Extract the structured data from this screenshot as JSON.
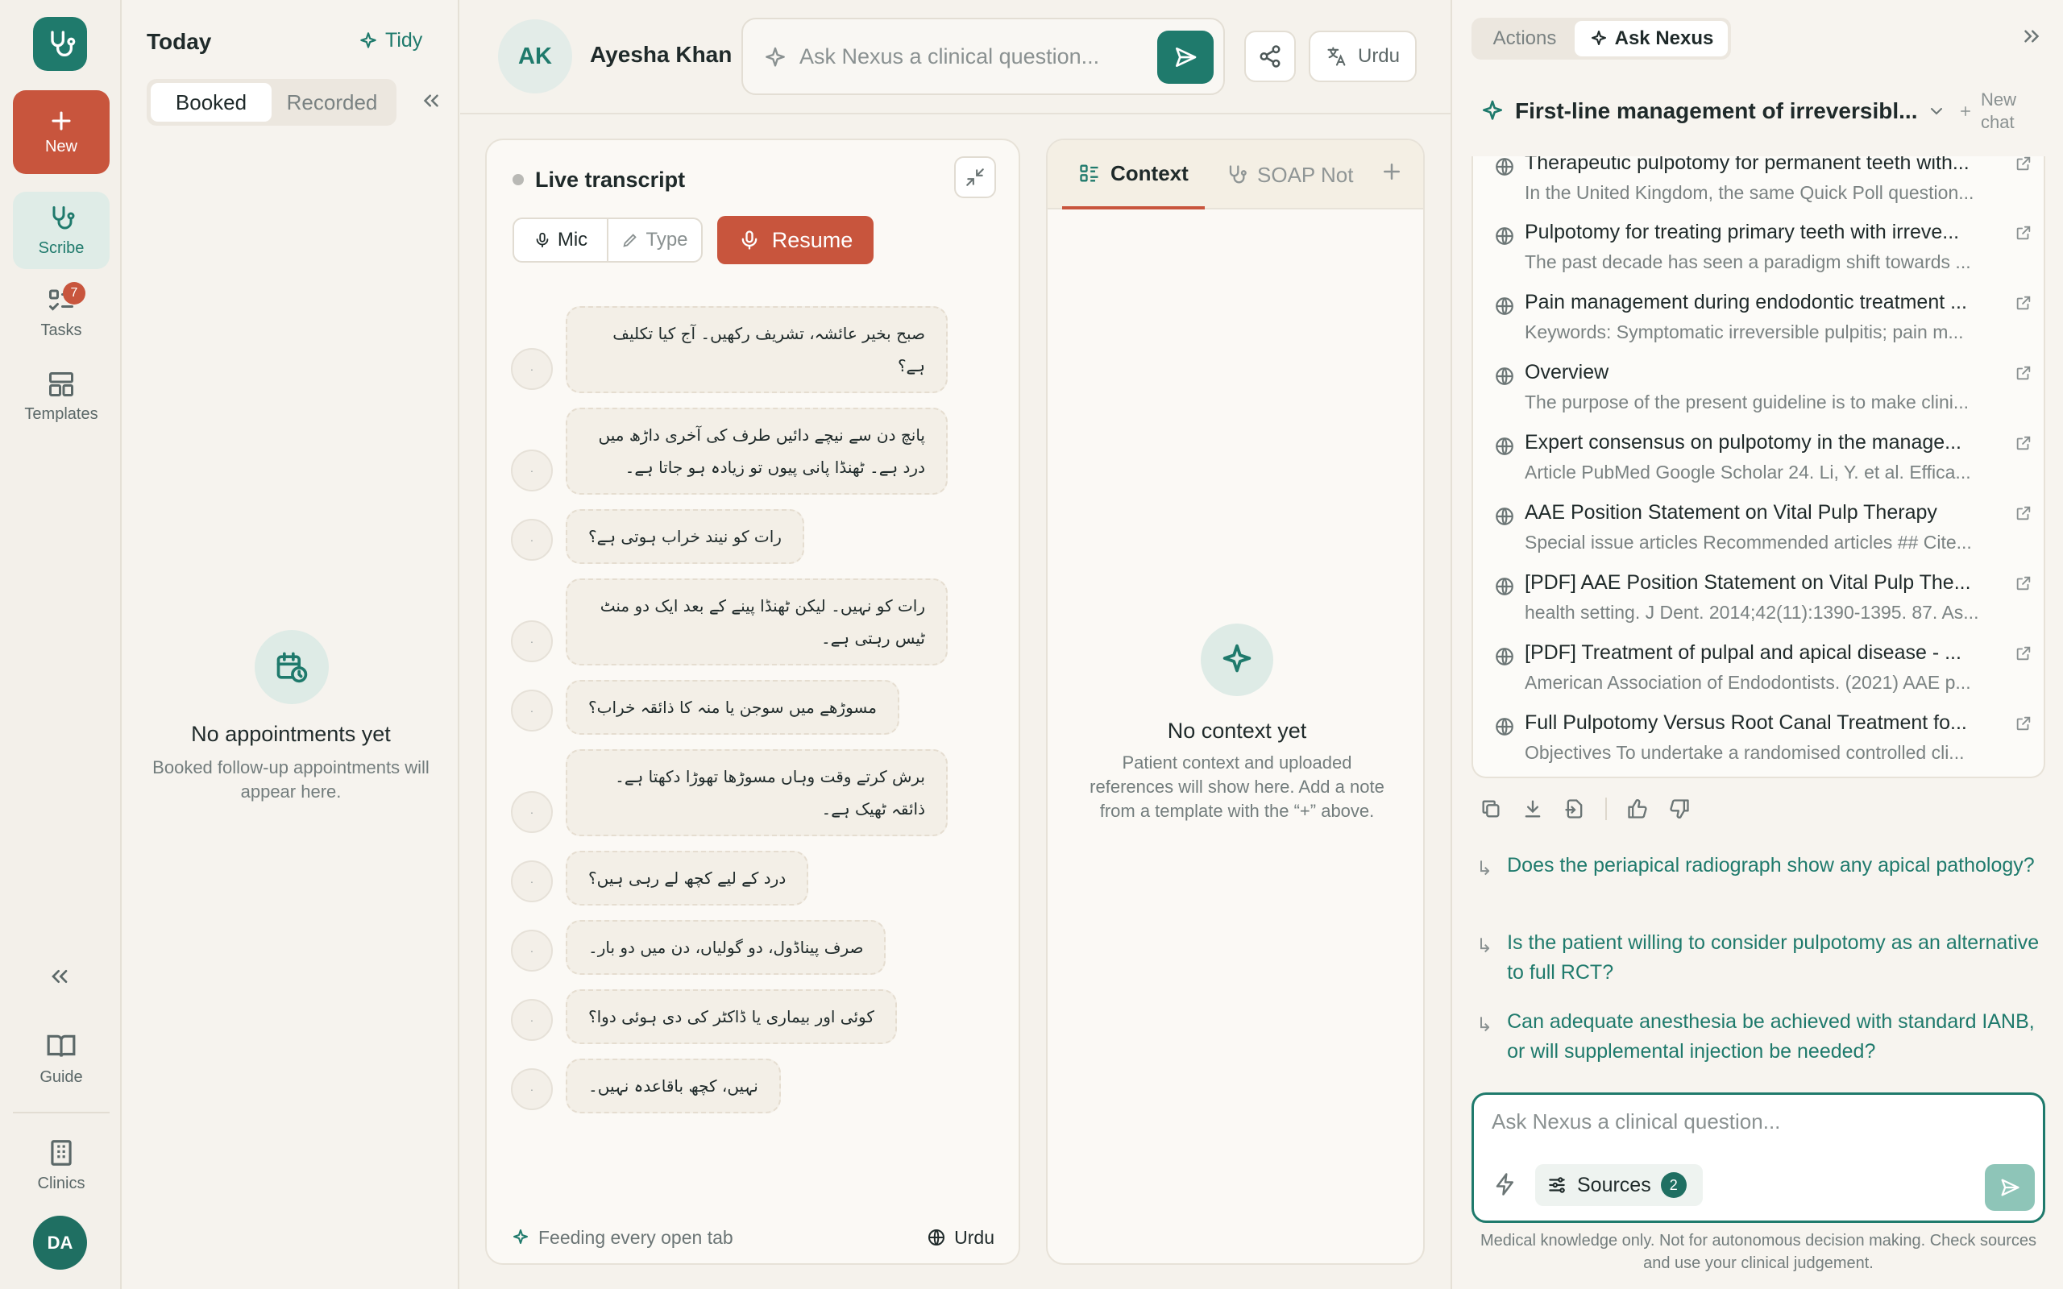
{
  "rail": {
    "new_label": "New",
    "items": [
      {
        "label": "Scribe",
        "icon": "stethoscope-icon"
      },
      {
        "label": "Tasks",
        "icon": "tasks-icon",
        "badge": "7"
      },
      {
        "label": "Templates",
        "icon": "templates-icon"
      }
    ],
    "guide_label": "Guide",
    "clinics_label": "Clinics",
    "avatar_initials": "DA"
  },
  "appointments": {
    "title": "Today",
    "tidy_label": "Tidy",
    "tabs": [
      "Booked",
      "Recorded"
    ],
    "empty_title": "No appointments yet",
    "empty_subtitle": "Booked follow-up appointments will appear here."
  },
  "topbar": {
    "patient_initials": "AK",
    "patient_name": "Ayesha Khan",
    "ask_placeholder": "Ask Nexus a clinical question...",
    "language": "Urdu"
  },
  "transcript": {
    "title": "Live transcript",
    "mode_mic": "Mic",
    "mode_type": "Type",
    "resume_label": "Resume",
    "messages": [
      "صبح بخیر عائشہ، تشریف رکھیں۔ آج کیا تکلیف ہے؟",
      "پانچ دن سے نیچے دائیں طرف کی آخری داڑھ میں درد ہے۔ ٹھنڈا پانی پیوں تو زیادہ ہو جاتا ہے۔",
      "رات کو نیند خراب ہوتی ہے؟",
      "رات کو نہیں۔ لیکن ٹھنڈا پینے کے بعد ایک دو منٹ ٹیس رہتی ہے۔",
      "مسوڑھے میں سوجن یا منہ کا ذائقہ خراب؟",
      "برش کرتے وقت وہاں مسوڑھا تھوڑا دکھتا ہے۔ ذائقہ ٹھیک ہے۔",
      "درد کے لیے کچھ لے رہی ہیں؟",
      "صرف پیناڈول، دو گولیاں، دن میں دو بار۔",
      "کوئی اور بیماری یا ڈاکٹر کی دی ہوئی دوا؟",
      "نہیں، کچھ باقاعدہ نہیں۔"
    ],
    "footer_feed": "Feeding every open tab",
    "footer_lang": "Urdu"
  },
  "context": {
    "tab_context": "Context",
    "tab_soap": "SOAP Not",
    "empty_title": "No context yet",
    "empty_subtitle": "Patient context and uploaded references will show here. Add a note from a template with the “+” above."
  },
  "nexus": {
    "tab_actions": "Actions",
    "tab_ask": "Ask Nexus",
    "chat_title": "First-line management of irreversibl...",
    "new_chat": "New chat",
    "sources": [
      {
        "title": "Therapeutic pulpotomy for permanent teeth with...",
        "excerpt": "In the United Kingdom, the same Quick Poll question..."
      },
      {
        "title": "Pulpotomy for treating primary teeth with irreve...",
        "excerpt": "The past decade has seen a paradigm shift towards ..."
      },
      {
        "title": "Pain management during endodontic treatment ...",
        "excerpt": "Keywords: Symptomatic irreversible pulpitis; pain m..."
      },
      {
        "title": "Overview",
        "excerpt": "The purpose of the present guideline is to make clini..."
      },
      {
        "title": "Expert consensus on pulpotomy in the manage...",
        "excerpt": "Article PubMed Google Scholar 24. Li, Y. et al. Effica..."
      },
      {
        "title": "AAE Position Statement on Vital Pulp Therapy",
        "excerpt": "Special issue articles Recommended articles ## Cite..."
      },
      {
        "title": "[PDF] AAE Position Statement on Vital Pulp The...",
        "excerpt": "health setting. J Dent. 2014;42(11):1390-1395. 87. As..."
      },
      {
        "title": "[PDF] Treatment of pulpal and apical disease - ...",
        "excerpt": "American Association of Endodontists. (2021) AAE p..."
      },
      {
        "title": "Full Pulpotomy Versus Root Canal Treatment fo...",
        "excerpt": "Objectives To undertake a randomised controlled cli..."
      }
    ],
    "followups": [
      "Does the periapical radiograph show any apical pathology?",
      "Is the patient willing to consider pulpotomy as an alternative to full RCT?",
      "Can adequate anesthesia be achieved with standard IANB, or will supplemental injection be needed?"
    ],
    "composer_placeholder": "Ask Nexus a clinical question...",
    "sources_label": "Sources",
    "sources_count": "2",
    "disclaimer": "Medical knowledge only. Not for autonomous decision making. Check sources and use your clinical judgement."
  },
  "colors": {
    "brand": "#1f7a6c",
    "accent": "#c8553d",
    "background": "#f5f2ec"
  }
}
